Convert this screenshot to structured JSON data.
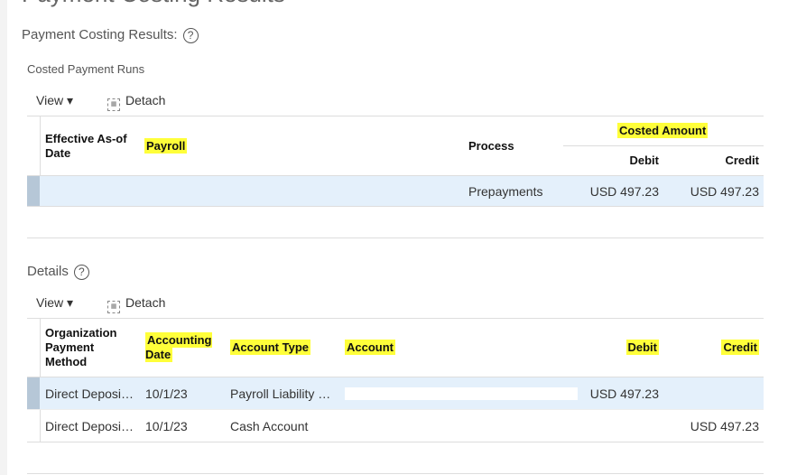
{
  "page_title": "Payment Costing Results",
  "section_title": "Payment Costing Results:",
  "help_glyph": "?",
  "runs": {
    "title": "Costed Payment Runs",
    "toolbar": {
      "view": "View ▾",
      "detach": "Detach"
    },
    "headers": {
      "date": "Effective As-of Date",
      "payroll": "Payroll",
      "process": "Process",
      "costed_amount": "Costed Amount",
      "debit": "Debit",
      "credit": "Credit"
    },
    "rows": [
      {
        "process": "Prepayments",
        "debit": "USD 497.23",
        "credit": "USD 497.23"
      }
    ]
  },
  "details": {
    "title": "Details",
    "toolbar": {
      "view": "View ▾",
      "detach": "Detach"
    },
    "headers": {
      "method": "Organization Payment Method",
      "acct_date": "Accounting Date",
      "acct_type": "Account Type",
      "account": "Account",
      "debit": "Debit",
      "credit": "Credit"
    },
    "rows": [
      {
        "method": "Direct Deposi…",
        "date": "10/1/23",
        "type": "Payroll Liability …",
        "debit": "USD 497.23",
        "credit": ""
      },
      {
        "method": "Direct Deposi…",
        "date": "10/1/23",
        "type": "Cash Account",
        "debit": "",
        "credit": "USD 497.23"
      }
    ]
  }
}
